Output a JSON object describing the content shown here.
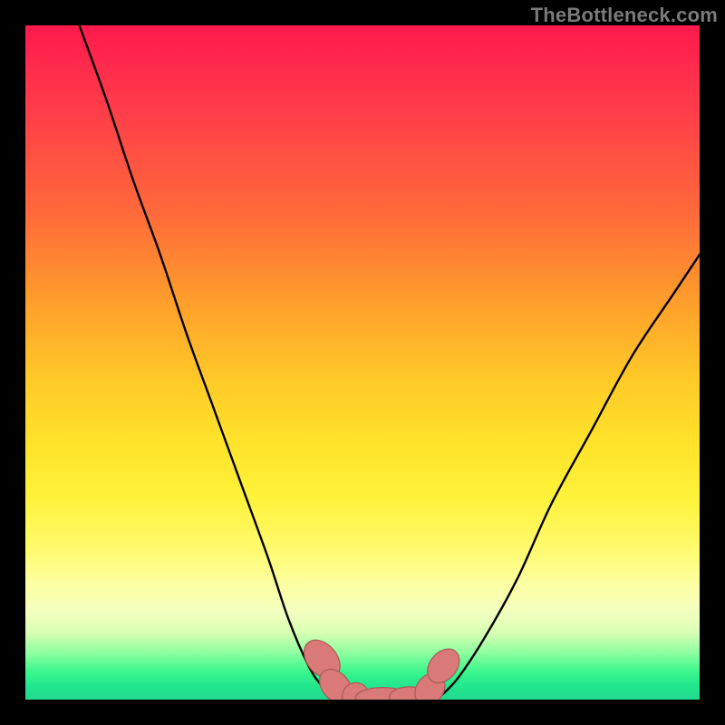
{
  "watermark": "TheBottleneck.com",
  "colors": {
    "frame": "#000000",
    "curve": "#000000",
    "marker_fill": "#d97a78",
    "marker_stroke": "#a85a55",
    "gradient_top": "#ff1a4d",
    "gradient_bottom": "#1fd98e"
  },
  "chart_data": {
    "type": "line",
    "title": "",
    "xlabel": "",
    "ylabel": "",
    "xlim": [
      0,
      100
    ],
    "ylim": [
      0,
      100
    ],
    "grid": false,
    "legend": false,
    "series": [
      {
        "name": "left-branch",
        "x": [
          8,
          12,
          16,
          20,
          24,
          28,
          32,
          36,
          39,
          42,
          44,
          46
        ],
        "y": [
          100,
          89,
          77,
          66,
          54,
          43,
          32,
          21,
          12,
          5,
          2,
          0
        ]
      },
      {
        "name": "valley-floor",
        "x": [
          46,
          49,
          52,
          55,
          58,
          61
        ],
        "y": [
          0,
          0,
          0,
          0,
          0,
          0
        ]
      },
      {
        "name": "right-branch",
        "x": [
          61,
          64,
          68,
          73,
          78,
          84,
          90,
          96,
          100
        ],
        "y": [
          0,
          3,
          9,
          18,
          29,
          40,
          51,
          60,
          66
        ]
      }
    ],
    "markers": [
      {
        "x": 44,
        "y": 6,
        "rx": 2.2,
        "ry": 3.2,
        "angle": -40
      },
      {
        "x": 46,
        "y": 2,
        "rx": 2.0,
        "ry": 2.8,
        "angle": -40
      },
      {
        "x": 49,
        "y": 0.5,
        "rx": 2.0,
        "ry": 2.0,
        "angle": 0
      },
      {
        "x": 53,
        "y": 0.3,
        "rx": 4.0,
        "ry": 1.5,
        "angle": 0
      },
      {
        "x": 57,
        "y": 0.4,
        "rx": 3.0,
        "ry": 1.5,
        "angle": 0
      },
      {
        "x": 60,
        "y": 1.5,
        "rx": 2.0,
        "ry": 2.6,
        "angle": 35
      },
      {
        "x": 62,
        "y": 5,
        "rx": 2.0,
        "ry": 2.8,
        "angle": 40
      }
    ]
  }
}
